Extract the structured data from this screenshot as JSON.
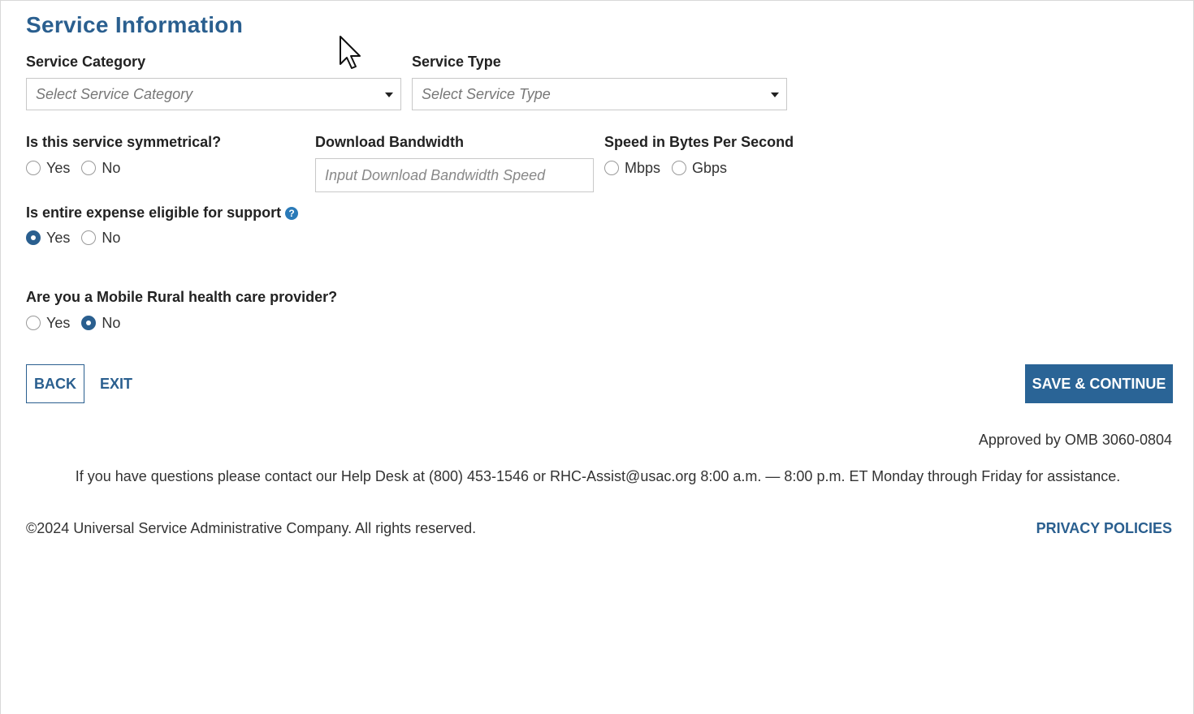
{
  "section_title": "Service Information",
  "service_category": {
    "label": "Service Category",
    "placeholder": "Select Service Category"
  },
  "service_type": {
    "label": "Service Type",
    "placeholder": "Select Service Type"
  },
  "symmetrical": {
    "label": "Is this service symmetrical?",
    "options": [
      "Yes",
      "No"
    ],
    "selected": null
  },
  "download_bandwidth": {
    "label": "Download Bandwidth",
    "placeholder": "Input Download Bandwidth Speed"
  },
  "speed_unit": {
    "label": "Speed in Bytes Per Second",
    "options": [
      "Mbps",
      "Gbps"
    ],
    "selected": null
  },
  "eligible": {
    "label": "Is entire expense eligible for support",
    "help_icon_glyph": "?",
    "options": [
      "Yes",
      "No"
    ],
    "selected": "Yes"
  },
  "mobile_provider": {
    "label": "Are you a Mobile Rural health care provider?",
    "options": [
      "Yes",
      "No"
    ],
    "selected": "No"
  },
  "buttons": {
    "back": "BACK",
    "exit": "EXIT",
    "save_continue": "SAVE & CONTINUE"
  },
  "footer": {
    "omb": "Approved by OMB 3060-0804",
    "helpdesk": "If you have questions please contact our Help Desk at (800) 453-1546 or RHC-Assist@usac.org 8:00 a.m. — 8:00 p.m. ET Monday through Friday for assistance.",
    "copyright": "©2024 Universal Service Administrative Company. All rights reserved.",
    "privacy": "PRIVACY POLICIES"
  },
  "colors": {
    "primary": "#2a5f8f",
    "button_fill": "#2a6496",
    "help_icon": "#2a7ab8"
  },
  "icons": [
    "dropdown-caret-icon",
    "help-question-icon",
    "mouse-pointer-icon"
  ]
}
